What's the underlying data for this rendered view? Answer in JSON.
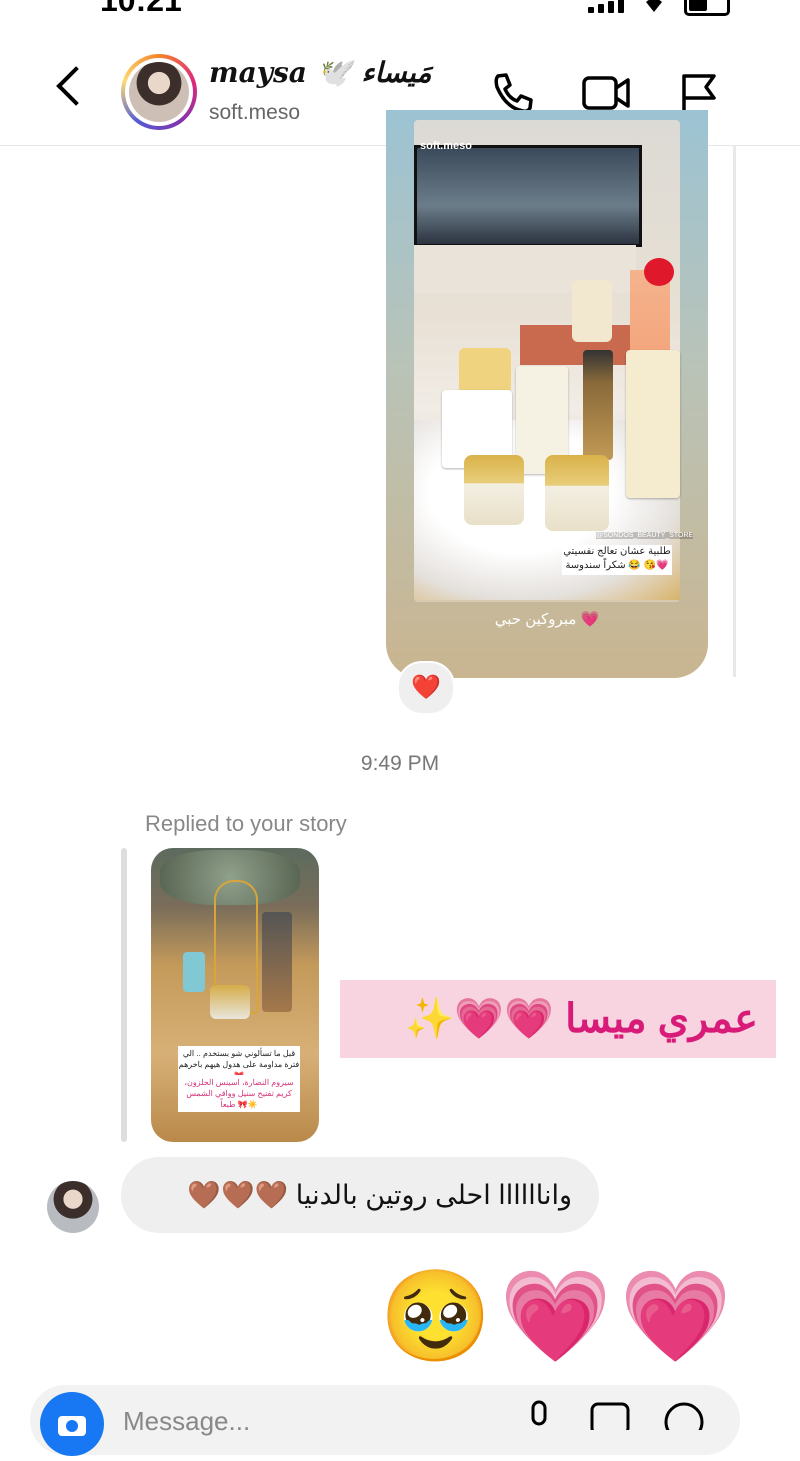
{
  "status_bar": {
    "time": "10:21"
  },
  "header": {
    "back_icon": "chevron-left-icon",
    "display_name": "𝒎𝒂𝒚𝒔𝒂 🕊️ مَيساء",
    "username": "soft.meso",
    "actions": [
      "phone-icon",
      "video-camera-icon",
      "flag-icon"
    ]
  },
  "story_1": {
    "handle": "soft.meso",
    "sticker_text": "طلبية عشان تعالج نفسيتي 😂 شكراً سندوسة 😘💗",
    "shop_tag": "@SONDOS_BEAUTY_STORE",
    "caption": "مبروكين حبي 💗",
    "reaction": "❤️"
  },
  "timestamp": "9:49 PM",
  "reply": {
    "label": "Replied to your story",
    "thumb_caption_1": "قبل ما تسألوني شو بستخدم .. الي فترة مداومة على هدول هيهم باخرهم 🎀",
    "thumb_caption_2": "سيروم النضارة، اسينس الحلزون، كريم تفتيح سنيل وواقي الشمس طبعاً 🎀☀️",
    "message": "عمري ميسا 💗💗✨"
  },
  "incoming_message": "واناااااا احلى روتين بالدنيا 🤎🤎🤎",
  "outgoing_emoji": "🥹💗💗",
  "composer": {
    "placeholder": "Message..."
  },
  "colors": {
    "accent_blue": "#1877f2",
    "pink_highlight": "#f7d4df",
    "pink_text": "#d81b79"
  }
}
